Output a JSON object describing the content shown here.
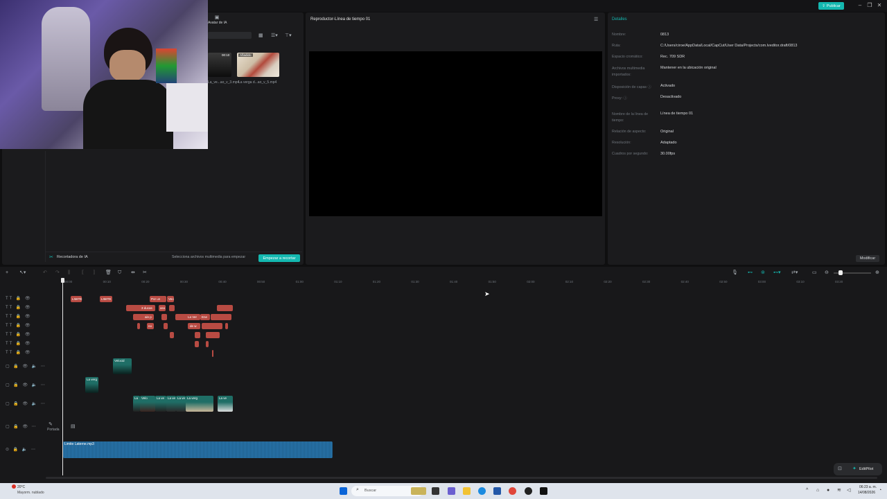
{
  "topbar": {
    "publish_label": "Publicar"
  },
  "media": {
    "tab_ai_label": "Avatar de IA",
    "thumb1_duration": "00:10",
    "thumb1_name": "La_ve...ao_v_3.mp4",
    "thumb2_badge": "Añadido",
    "thumb2_name": "La verga d...ao_v_5.mp4"
  },
  "cropper": {
    "title": "Recortadora de IA",
    "hint": "Selecciona archivos multimedia para empezar",
    "start_label": "Empezar a recortar"
  },
  "player": {
    "title": "Reproductor-Línea de tiempo 01"
  },
  "details": {
    "title": "Detalles",
    "rows": [
      {
        "label": "Nombre:",
        "value": "0813"
      },
      {
        "label": "Ruta:",
        "value": "C:/Users/ciroe/AppData/Local/CapCut/User Data/Projects/com.lveditor.draft/0813"
      },
      {
        "label": "Espacio cromático:",
        "value": "Rec. 709 SDR"
      },
      {
        "label": "Archivos multimedia importados:",
        "value": "Mantener en la ubicación original"
      },
      {
        "label": "Disposición de capas ⓘ",
        "value": "Activado"
      },
      {
        "label": "Proxy: ⓘ",
        "value": "Desactivado"
      },
      {
        "label": "Nombre de la línea de tiempo:",
        "value": "Línea de tiempo 01"
      },
      {
        "label": "Relación de aspecto:",
        "value": "Original"
      },
      {
        "label": "Resolución:",
        "value": "Adaptado"
      },
      {
        "label": "Cuadros por segundo:",
        "value": "30.00fps"
      }
    ],
    "modify_label": "Modificar"
  },
  "ruler": {
    "ticks": [
      "00:00",
      "00:10",
      "00:20",
      "00:30",
      "00:40",
      "00:50",
      "01:00",
      "01:10",
      "01:20",
      "01:30",
      "01:40",
      "01:50",
      "02:00",
      "02:10",
      "02:20",
      "02:30",
      "02:40",
      "02:50",
      "03:00",
      "03:10",
      "03:20"
    ]
  },
  "timeline": {
    "text_clips": [
      "LIMITE",
      "LIMITE",
      "Por un",
      "Veo",
      "3 ducas",
      "aso",
      "ain p",
      "La Ver",
      "Ene",
      "de w",
      "no"
    ],
    "video_clips": [
      "Velocid",
      "La verg",
      "La",
      "Velo",
      "La ve",
      "La ve",
      "La ve",
      "La verg",
      "La ve"
    ],
    "cover_label": "Portada",
    "audio_clip": "Limite Laterne.mp3"
  },
  "editpilot": {
    "label": "EditPilot"
  },
  "taskbar": {
    "weather_temp": "20°C",
    "weather_desc": "Mayorm. nublado",
    "search_placeholder": "Buscar",
    "time": "06:23 a. m.",
    "date": "14/08/2026"
  },
  "colors": {
    "accent": "#14b8b0",
    "text_clip": "#b84b43",
    "video_clip": "#1f6e66",
    "audio_clip": "#1d5a86"
  }
}
